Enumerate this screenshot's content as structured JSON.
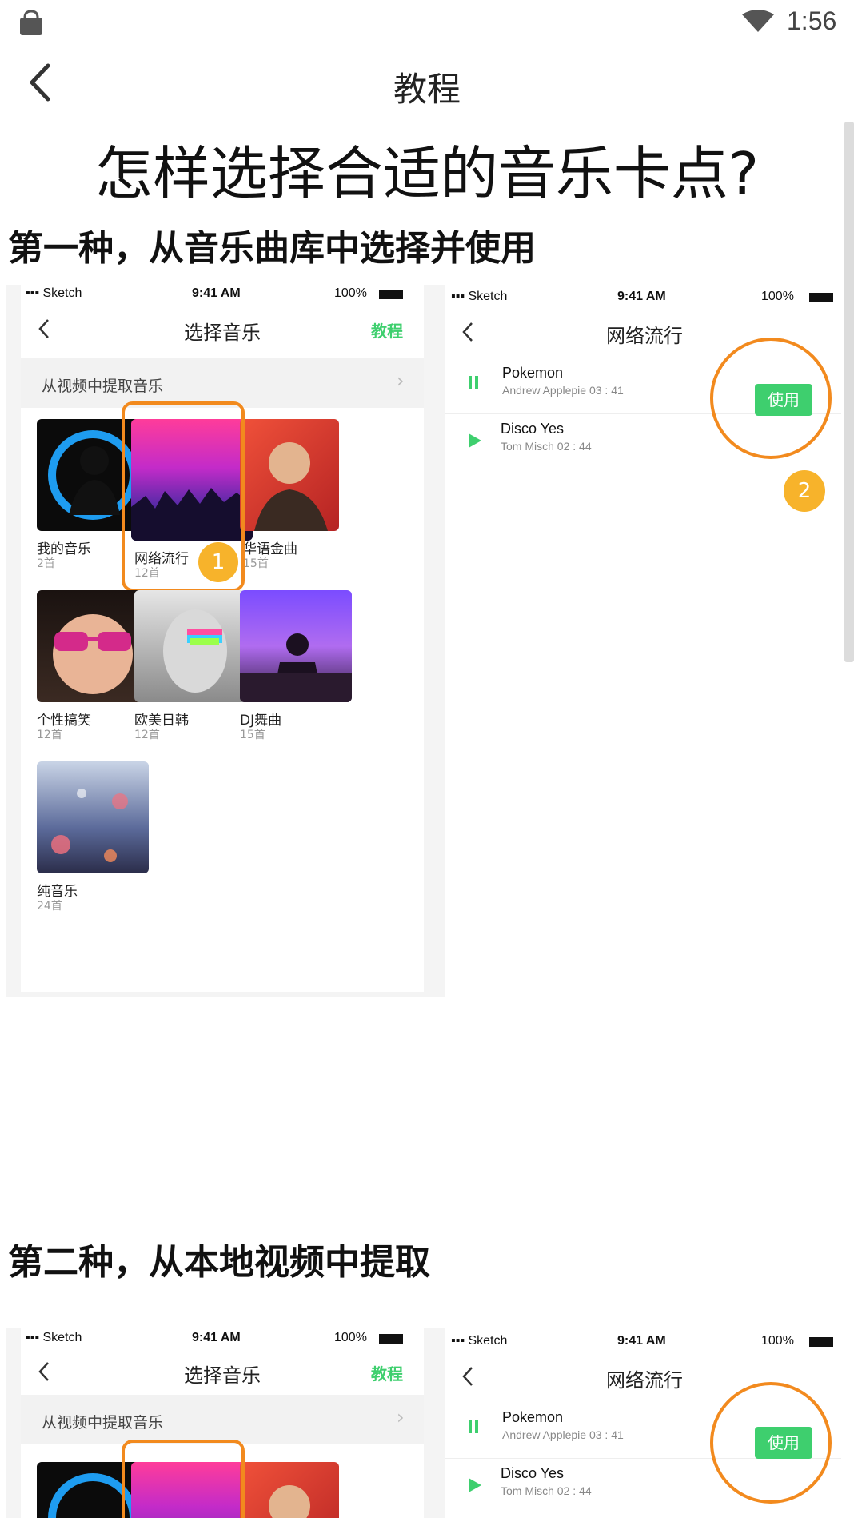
{
  "status_bar": {
    "time": "1:56",
    "icons": [
      "bag-icon",
      "wifi-icon"
    ]
  },
  "app_bar": {
    "title": "教程",
    "back_icon": "chevron-left-icon"
  },
  "heading": "怎样选择合适的音乐卡点?",
  "section1": {
    "title": "第一种，从音乐曲库中选择并使用"
  },
  "section2": {
    "title": "第二种，从本地视频中提取"
  },
  "phone_left": {
    "status": {
      "carrier": "Sketch",
      "time": "9:41 AM",
      "battery": "100%"
    },
    "title": "选择音乐",
    "tutorial_link": "教程",
    "extract_row": "从视频中提取音乐",
    "categories": [
      {
        "name": "我的音乐",
        "count": "2首"
      },
      {
        "name": "网络流行",
        "count": "12首"
      },
      {
        "name": "华语金曲",
        "count": "15首"
      },
      {
        "name": "个性搞笑",
        "count": "12首"
      },
      {
        "name": "欧美日韩",
        "count": "12首"
      },
      {
        "name": "DJ舞曲",
        "count": "15首"
      },
      {
        "name": "纯音乐",
        "count": "24首"
      }
    ],
    "step_badge": "1"
  },
  "phone_right": {
    "status": {
      "carrier": "Sketch",
      "time": "9:41 AM",
      "battery": "100%"
    },
    "title": "网络流行",
    "tracks": [
      {
        "title": "Pokemon",
        "meta": "Andrew Applepie  03 : 41",
        "state": "pause-icon"
      },
      {
        "title": "Disco Yes",
        "meta": "Tom Misch   02 : 44",
        "state": "play-icon"
      }
    ],
    "use_button": "使用",
    "step_badge": "2"
  },
  "colors": {
    "accent_green": "#3ecf6e",
    "highlight_orange": "#f28a1e",
    "badge_yellow": "#f7b32b"
  }
}
